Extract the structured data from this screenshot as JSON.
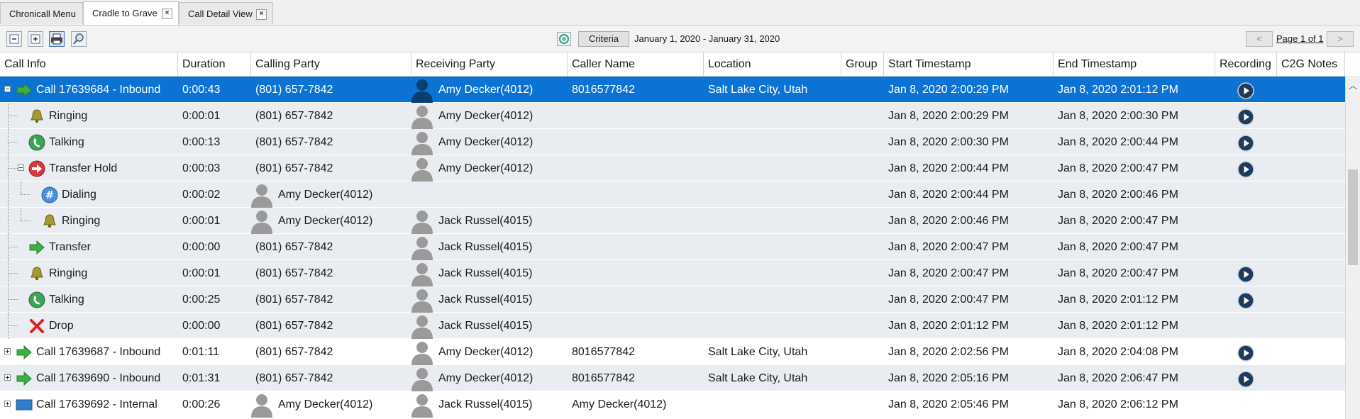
{
  "tabs": [
    {
      "label": "Chronicall Menu",
      "closable": false,
      "active": false
    },
    {
      "label": "Cradle to Grave",
      "closable": true,
      "active": true
    },
    {
      "label": "Call Detail View",
      "closable": true,
      "active": false
    }
  ],
  "toolbar": {
    "icons": [
      "collapse-all-icon",
      "expand-all-icon",
      "print-icon",
      "search-icon"
    ],
    "criteria_label": "Criteria",
    "date_range": "January 1, 2020 - January 31, 2020",
    "prev_label": "<",
    "next_label": ">",
    "page_info": "Page 1 of 1"
  },
  "columns": [
    "Call Info",
    "Duration",
    "Calling Party",
    "Receiving Party",
    "Caller Name",
    "Location",
    "Group",
    "Start Timestamp",
    "End Timestamp",
    "Recording",
    "C2G Notes"
  ],
  "rows": [
    {
      "kind": "call",
      "expander": "minus",
      "icon": "inbound-arrow-icon",
      "label": "Call 17639684 - Inbound",
      "duration": "0:00:43",
      "calling": "(801) 657-7842",
      "calling_avatar": false,
      "receiving": "Amy Decker(4012)",
      "receiving_avatar": true,
      "caller_name": "8016577842",
      "location": "Salt Lake City, Utah",
      "group": "",
      "start": "Jan 8, 2020 2:00:29 PM",
      "end": "Jan 8, 2020 2:01:12 PM",
      "recording": true,
      "style": "sel"
    },
    {
      "kind": "event",
      "level": 1,
      "icon": "bell-icon",
      "label": "Ringing",
      "duration": "0:00:01",
      "calling": "(801) 657-7842",
      "calling_avatar": false,
      "receiving": "Amy Decker(4012)",
      "receiving_avatar": true,
      "caller_name": "",
      "location": "",
      "group": "",
      "start": "Jan 8, 2020 2:00:29 PM",
      "end": "Jan 8, 2020 2:00:30 PM",
      "recording": true,
      "style": "child"
    },
    {
      "kind": "event",
      "level": 1,
      "icon": "phone-talking-icon",
      "label": "Talking",
      "duration": "0:00:13",
      "calling": "(801) 657-7842",
      "calling_avatar": false,
      "receiving": "Amy Decker(4012)",
      "receiving_avatar": true,
      "caller_name": "",
      "location": "",
      "group": "",
      "start": "Jan 8, 2020 2:00:30 PM",
      "end": "Jan 8, 2020 2:00:44 PM",
      "recording": true,
      "style": "child"
    },
    {
      "kind": "event",
      "level": 1,
      "expander": "minus",
      "icon": "transfer-hold-icon",
      "label": "Transfer Hold",
      "duration": "0:00:03",
      "calling": "(801) 657-7842",
      "calling_avatar": false,
      "receiving": "Amy Decker(4012)",
      "receiving_avatar": true,
      "caller_name": "",
      "location": "",
      "group": "",
      "start": "Jan 8, 2020 2:00:44 PM",
      "end": "Jan 8, 2020 2:00:47 PM",
      "recording": true,
      "style": "child"
    },
    {
      "kind": "event",
      "level": 2,
      "icon": "dialing-hash-icon",
      "label": "Dialing",
      "duration": "0:00:02",
      "calling": "Amy Decker(4012)",
      "calling_avatar": true,
      "receiving": "",
      "receiving_avatar": false,
      "caller_name": "",
      "location": "",
      "group": "",
      "start": "Jan 8, 2020 2:00:44 PM",
      "end": "Jan 8, 2020 2:00:46 PM",
      "recording": false,
      "style": "child"
    },
    {
      "kind": "event",
      "level": 2,
      "icon": "bell-icon",
      "label": "Ringing",
      "duration": "0:00:01",
      "calling": "Amy Decker(4012)",
      "calling_avatar": true,
      "receiving": "Jack Russel(4015)",
      "receiving_avatar": true,
      "caller_name": "",
      "location": "",
      "group": "",
      "start": "Jan 8, 2020 2:00:46 PM",
      "end": "Jan 8, 2020 2:00:47 PM",
      "recording": false,
      "style": "child"
    },
    {
      "kind": "event",
      "level": 1,
      "icon": "transfer-arrow-icon",
      "label": "Transfer",
      "duration": "0:00:00",
      "calling": "(801) 657-7842",
      "calling_avatar": false,
      "receiving": "Jack Russel(4015)",
      "receiving_avatar": true,
      "caller_name": "",
      "location": "",
      "group": "",
      "start": "Jan 8, 2020 2:00:47 PM",
      "end": "Jan 8, 2020 2:00:47 PM",
      "recording": false,
      "style": "child"
    },
    {
      "kind": "event",
      "level": 1,
      "icon": "bell-icon",
      "label": "Ringing",
      "duration": "0:00:01",
      "calling": "(801) 657-7842",
      "calling_avatar": false,
      "receiving": "Jack Russel(4015)",
      "receiving_avatar": true,
      "caller_name": "",
      "location": "",
      "group": "",
      "start": "Jan 8, 2020 2:00:47 PM",
      "end": "Jan 8, 2020 2:00:47 PM",
      "recording": true,
      "style": "child"
    },
    {
      "kind": "event",
      "level": 1,
      "icon": "phone-talking-icon",
      "label": "Talking",
      "duration": "0:00:25",
      "calling": "(801) 657-7842",
      "calling_avatar": false,
      "receiving": "Jack Russel(4015)",
      "receiving_avatar": true,
      "caller_name": "",
      "location": "",
      "group": "",
      "start": "Jan 8, 2020 2:00:47 PM",
      "end": "Jan 8, 2020 2:01:12 PM",
      "recording": true,
      "style": "child"
    },
    {
      "kind": "event",
      "level": 1,
      "icon": "drop-x-icon",
      "label": "Drop",
      "duration": "0:00:00",
      "calling": "(801) 657-7842",
      "calling_avatar": false,
      "receiving": "Jack Russel(4015)",
      "receiving_avatar": true,
      "caller_name": "",
      "location": "",
      "group": "",
      "start": "Jan 8, 2020 2:01:12 PM",
      "end": "Jan 8, 2020 2:01:12 PM",
      "recording": false,
      "style": "child"
    },
    {
      "kind": "call",
      "expander": "plus",
      "icon": "inbound-arrow-icon",
      "label": "Call 17639687 - Inbound",
      "duration": "0:01:11",
      "calling": "(801) 657-7842",
      "calling_avatar": false,
      "receiving": "Amy Decker(4012)",
      "receiving_avatar": true,
      "caller_name": "8016577842",
      "location": "Salt Lake City, Utah",
      "group": "",
      "start": "Jan 8, 2020 2:02:56 PM",
      "end": "Jan 8, 2020 2:04:08 PM",
      "recording": true,
      "style": "white"
    },
    {
      "kind": "call",
      "expander": "plus",
      "icon": "inbound-arrow-icon",
      "label": "Call 17639690 - Inbound",
      "duration": "0:01:31",
      "calling": "(801) 657-7842",
      "calling_avatar": false,
      "receiving": "Amy Decker(4012)",
      "receiving_avatar": true,
      "caller_name": "8016577842",
      "location": "Salt Lake City, Utah",
      "group": "",
      "start": "Jan 8, 2020 2:05:16 PM",
      "end": "Jan 8, 2020 2:06:47 PM",
      "recording": true,
      "style": "grey"
    },
    {
      "kind": "call",
      "expander": "plus",
      "icon": "internal-monitor-icon",
      "label": "Call 17639692 - Internal",
      "duration": "0:00:26",
      "calling": "Amy Decker(4012)",
      "calling_avatar": true,
      "receiving": "Jack Russel(4015)",
      "receiving_avatar": true,
      "caller_name": "Amy Decker(4012)",
      "location": "",
      "group": "",
      "start": "Jan 8, 2020 2:05:46 PM",
      "end": "Jan 8, 2020 2:06:12 PM",
      "recording": false,
      "style": "white"
    }
  ],
  "colors": {
    "selected": "#0a73d3",
    "child_row": "#e9edf2",
    "inbound_green": "#3cb043",
    "play_button": "#1f3a5c"
  }
}
